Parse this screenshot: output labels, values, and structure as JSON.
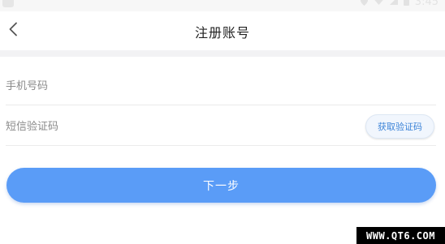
{
  "status_bar": {
    "time": "3:45",
    "icons": [
      "location-icon",
      "wifi-icon",
      "signal-icon",
      "battery-icon"
    ]
  },
  "header": {
    "title": "注册账号",
    "back_icon": "chevron-left-icon"
  },
  "form": {
    "phone": {
      "placeholder": "手机号码",
      "value": ""
    },
    "sms_code": {
      "placeholder": "短信验证码",
      "value": ""
    },
    "get_code_label": "获取验证码"
  },
  "actions": {
    "next_label": "下一步"
  },
  "watermark": {
    "text": "WWW.QT6.COM"
  },
  "colors": {
    "accent": "#5a9cf7",
    "code_button_text": "#3d84d8",
    "divider": "#ebebeb",
    "section_gap": "#f2f2f4"
  }
}
